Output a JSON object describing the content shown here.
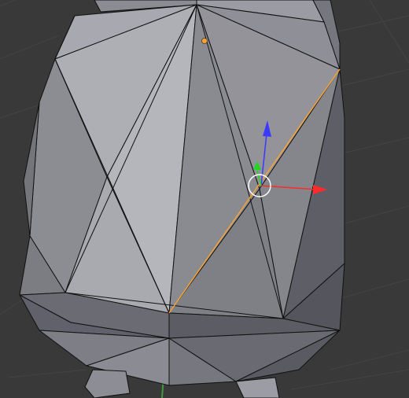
{
  "viewport": {
    "background_color": "#393939",
    "grid_color": "#444444",
    "axis_green_color": "#3f9a3f",
    "mesh_wire_color": "#111111",
    "selected_edge_color": "#f5a334",
    "selected_vertex_color": "#f5a334",
    "manipulator": {
      "x_axis_color": "#ff2a2a",
      "y_axis_color": "#21d821",
      "z_axis_color": "#3a3aff",
      "center_ring_color": "#ffffff",
      "icons": [
        "x-axis-arrow-icon",
        "y-axis-arrow-icon",
        "z-axis-arrow-icon",
        "transform-center-ring-icon"
      ]
    }
  }
}
